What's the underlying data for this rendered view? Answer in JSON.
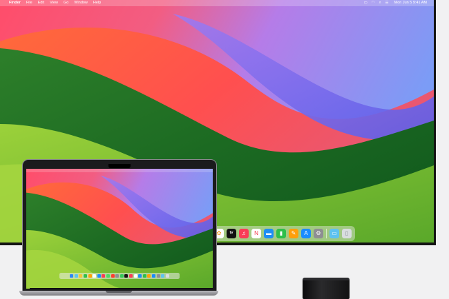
{
  "menubar": {
    "apple_glyph": "",
    "app_name": "Finder",
    "items": [
      "File",
      "Edit",
      "View",
      "Go",
      "Window",
      "Help"
    ],
    "status_icons": [
      "battery-icon",
      "wifi-icon",
      "search-icon",
      "control-center-icon"
    ],
    "clock": "Mon Jun 5 9:41 AM"
  },
  "dock": {
    "icons": [
      {
        "name": "photos-icon",
        "bg": "#ffffff",
        "glyph": "✿",
        "fg": "#f29a1f"
      },
      {
        "name": "apple-tv-icon",
        "bg": "#111111",
        "glyph": "tv",
        "fg": "#ffffff"
      },
      {
        "name": "music-icon",
        "bg": "#fa3c57",
        "glyph": "♫",
        "fg": "#ffffff"
      },
      {
        "name": "news-icon",
        "bg": "#ffffff",
        "glyph": "N",
        "fg": "#f2384a"
      },
      {
        "name": "keynote-icon",
        "bg": "#1e8ef4",
        "glyph": "▬",
        "fg": "#ffffff"
      },
      {
        "name": "numbers-icon",
        "bg": "#2fbf4a",
        "glyph": "▮",
        "fg": "#ffffff"
      },
      {
        "name": "pages-icon",
        "bg": "#ff9f0a",
        "glyph": "✎",
        "fg": "#ffffff"
      },
      {
        "name": "app-store-icon",
        "bg": "#1a8cff",
        "glyph": "A",
        "fg": "#ffffff"
      },
      {
        "name": "system-settings-icon",
        "bg": "#8e8e93",
        "glyph": "⚙",
        "fg": "#ffffff"
      }
    ],
    "trailing_icons": [
      {
        "name": "downloads-folder-icon",
        "bg": "#5ec2f0",
        "glyph": "▭",
        "fg": "#ffffff"
      },
      {
        "name": "trash-icon",
        "bg": "#d9dde0",
        "glyph": "▯",
        "fg": "#8a9096"
      }
    ]
  },
  "macbook_dock_colors": [
    "#2f86f6",
    "#5ec3f0",
    "#f6c23a",
    "#2fbf4a",
    "#ff9f0a",
    "#ffffff",
    "#1a8cff",
    "#fa3c57",
    "#4cd964",
    "#ff3b30",
    "#8e8e93",
    "#34c759",
    "#111111",
    "#fa3c57",
    "#ffffff",
    "#1e8ef4",
    "#2fbf4a",
    "#ff9f0a",
    "#1a8cff",
    "#8e8e93",
    "#5ec2f0",
    "#d9dde0"
  ],
  "colors": {
    "wallpaper_red": "#ff5b4e",
    "wallpaper_purple": "#7f6ff0",
    "wallpaper_green": "#3f9a2a",
    "wallpaper_dark_green": "#0f5a1e"
  }
}
